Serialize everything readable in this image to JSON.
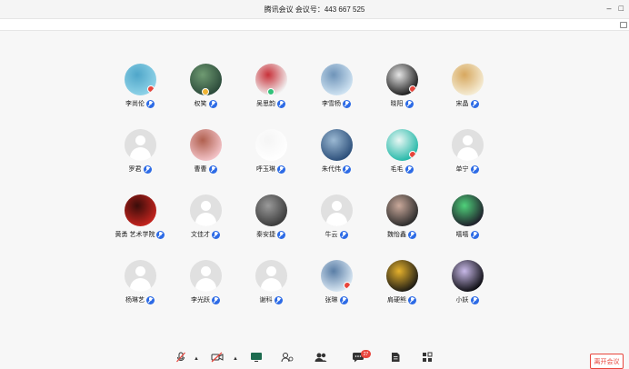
{
  "window": {
    "title": "腾讯会议  会议号：443 667 525",
    "minimize_glyph": "–",
    "restore_glyph": "□"
  },
  "participants": [
    {
      "name": "李尚伦",
      "avatar": "photo",
      "colors": [
        "#8fd3e8",
        "#4fa6c9"
      ],
      "badge": "red"
    },
    {
      "name": "权笑",
      "avatar": "photo",
      "colors": [
        "#2b4a3a",
        "#6f9b72"
      ],
      "badge": "gold"
    },
    {
      "name": "吴思韵",
      "avatar": "photo",
      "colors": [
        "#f2f2f2",
        "#c8323a"
      ],
      "badge": "green"
    },
    {
      "name": "李雪杨",
      "avatar": "photo",
      "colors": [
        "#cfe3f2",
        "#6f94b9"
      ],
      "badge": ""
    },
    {
      "name": "晓阳",
      "avatar": "photo",
      "colors": [
        "#1d1d1d",
        "#e5e5e5"
      ],
      "badge": "red"
    },
    {
      "name": "宋晶",
      "avatar": "photo",
      "colors": [
        "#f5ecd4",
        "#d7a85f"
      ],
      "badge": ""
    },
    {
      "name": "罗君",
      "avatar": "default",
      "colors": [],
      "badge": ""
    },
    {
      "name": "曹曹",
      "avatar": "photo",
      "colors": [
        "#f3c3c8",
        "#b0604f"
      ],
      "badge": ""
    },
    {
      "name": "呼玉琳",
      "avatar": "photo",
      "colors": [
        "#ffffff",
        "#f5f5f5"
      ],
      "badge": ""
    },
    {
      "name": "朱代伟",
      "avatar": "photo",
      "colors": [
        "#2c4f7a",
        "#9bb9d3"
      ],
      "badge": ""
    },
    {
      "name": "毛毛",
      "avatar": "photo",
      "colors": [
        "#24b8a8",
        "#e9f7f4"
      ],
      "badge": "red"
    },
    {
      "name": "单宁",
      "avatar": "default",
      "colors": [],
      "badge": ""
    },
    {
      "name": "黄勇 艺术学院",
      "avatar": "photo",
      "colors": [
        "#c5241e",
        "#3a0d0a"
      ],
      "badge": ""
    },
    {
      "name": "文佳才",
      "avatar": "default",
      "colors": [],
      "badge": ""
    },
    {
      "name": "秦安捷",
      "avatar": "photo",
      "colors": [
        "#3a3a3a",
        "#9a9a9a"
      ],
      "badge": ""
    },
    {
      "name": "牛云",
      "avatar": "default",
      "colors": [],
      "badge": ""
    },
    {
      "name": "魏怡鑫",
      "avatar": "photo",
      "colors": [
        "#2a2a2a",
        "#c9a89a"
      ],
      "badge": ""
    },
    {
      "name": "嘻嘻",
      "avatar": "photo",
      "colors": [
        "#1e1e2a",
        "#4fd17a"
      ],
      "badge": ""
    },
    {
      "name": "杨琳艺",
      "avatar": "default",
      "colors": [],
      "badge": ""
    },
    {
      "name": "李光跃",
      "avatar": "default",
      "colors": [],
      "badge": ""
    },
    {
      "name": "谢科",
      "avatar": "default",
      "colors": [],
      "badge": ""
    },
    {
      "name": "张琳",
      "avatar": "photo",
      "colors": [
        "#d9e7f3",
        "#5a7ea6"
      ],
      "badge": "red"
    },
    {
      "name": "肩硬熊",
      "avatar": "photo",
      "colors": [
        "#1d1b14",
        "#e5b12c"
      ],
      "badge": ""
    },
    {
      "name": "小妖",
      "avatar": "photo",
      "colors": [
        "#0d0d12",
        "#c8b9e8"
      ],
      "badge": ""
    }
  ],
  "toolbar": {
    "chat_count": "27",
    "leave_label": "离开会议"
  },
  "colors": {
    "mic_blue": "#2d6be6",
    "leave_red": "#e8453c"
  }
}
